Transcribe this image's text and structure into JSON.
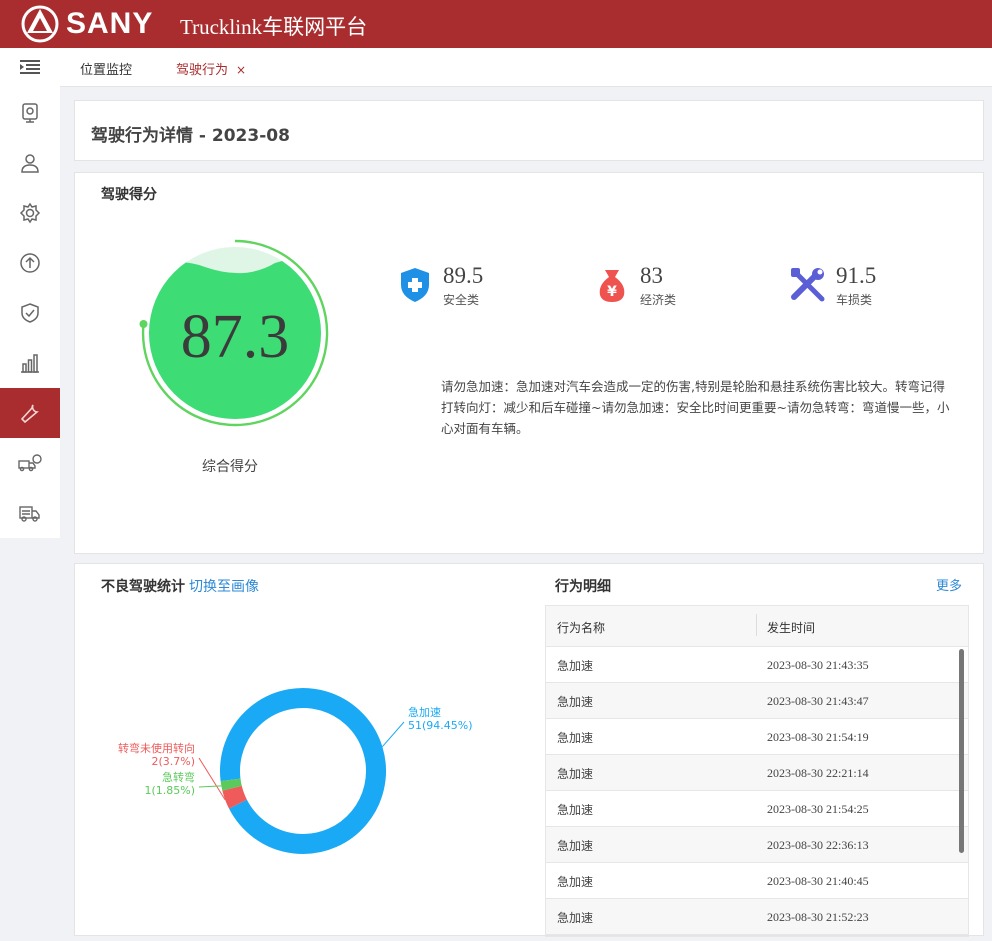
{
  "header": {
    "brand": "SANY",
    "app_title": "Trucklink车联网平台"
  },
  "sidebar": {
    "items": [
      {
        "icon": "monitor-icon"
      },
      {
        "icon": "user-icon"
      },
      {
        "icon": "gear-icon"
      },
      {
        "icon": "upload-icon"
      },
      {
        "icon": "shield-icon"
      },
      {
        "icon": "bar-chart-icon"
      },
      {
        "icon": "wrench-icon",
        "active": true
      },
      {
        "icon": "fleet-icon"
      },
      {
        "icon": "truck-icon"
      }
    ]
  },
  "tabs": [
    {
      "label": "位置监控"
    },
    {
      "label": "驾驶行为",
      "active": true,
      "close": "×"
    }
  ],
  "page": {
    "title": "驾驶行为详情 - 2023-08"
  },
  "score": {
    "section_title": "驾驶得分",
    "overall": "87.3",
    "overall_label": "综合得分",
    "metrics": [
      {
        "value": "89.5",
        "label": "安全类",
        "icon": "shield-plus-icon",
        "color": "#1e90e6"
      },
      {
        "value": "83",
        "label": "经济类",
        "icon": "money-bag-icon",
        "color": "#ef5350"
      },
      {
        "value": "91.5",
        "label": "车损类",
        "icon": "tools-icon",
        "color": "#5b5fd6"
      }
    ],
    "advice": "请勿急加速：急加速对汽车会造成一定的伤害,特别是轮胎和悬挂系统伤害比较大。转弯记得打转向灯：减少和后车碰撞~请勿急加速：安全比时间更重要~请勿急转弯：弯道慢一些，小心对面有车辆。"
  },
  "bad_driving": {
    "title": "不良驾驶统计",
    "switch_link": "切换至画像",
    "chart_data": {
      "type": "pie",
      "categories": [
        "急加速",
        "转弯未使用转向",
        "急转弯"
      ],
      "values": [
        51,
        2,
        1
      ],
      "labels": [
        "51(94.45%)",
        "2(3.7%)",
        "1(1.85%)"
      ],
      "colors": [
        "#1aa9f5",
        "#ef5b5b",
        "#5cc95c"
      ]
    }
  },
  "details": {
    "title": "行为明细",
    "more": "更多",
    "columns": [
      "行为名称",
      "发生时间"
    ],
    "rows": [
      [
        "急加速",
        "2023-08-30 21:43:35"
      ],
      [
        "急加速",
        "2023-08-30 21:43:47"
      ],
      [
        "急加速",
        "2023-08-30 21:54:19"
      ],
      [
        "急加速",
        "2023-08-30 22:21:14"
      ],
      [
        "急加速",
        "2023-08-30 21:54:25"
      ],
      [
        "急加速",
        "2023-08-30 22:36:13"
      ],
      [
        "急加速",
        "2023-08-30 21:40:45"
      ],
      [
        "急加速",
        "2023-08-30 21:52:23"
      ]
    ]
  }
}
